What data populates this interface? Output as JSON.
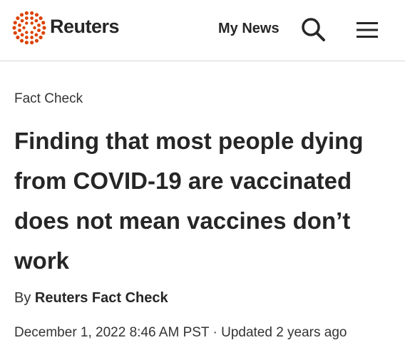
{
  "header": {
    "brand": "Reuters",
    "my_news_label": "My News",
    "icons": {
      "logo": "reuters-dot-logo",
      "search": "search-icon",
      "menu": "hamburger-menu-icon"
    },
    "accent_color": "#dc4300"
  },
  "article": {
    "kicker": "Fact Check",
    "headline": "Finding that most people dying from COVID-19 are vaccinated does not mean vaccines don’t work",
    "byline_prefix": "By",
    "author": "Reuters Fact Check",
    "published": "December 1, 2022 8:46 AM PST",
    "separator": "·",
    "updated": "Updated 2 years ago"
  }
}
